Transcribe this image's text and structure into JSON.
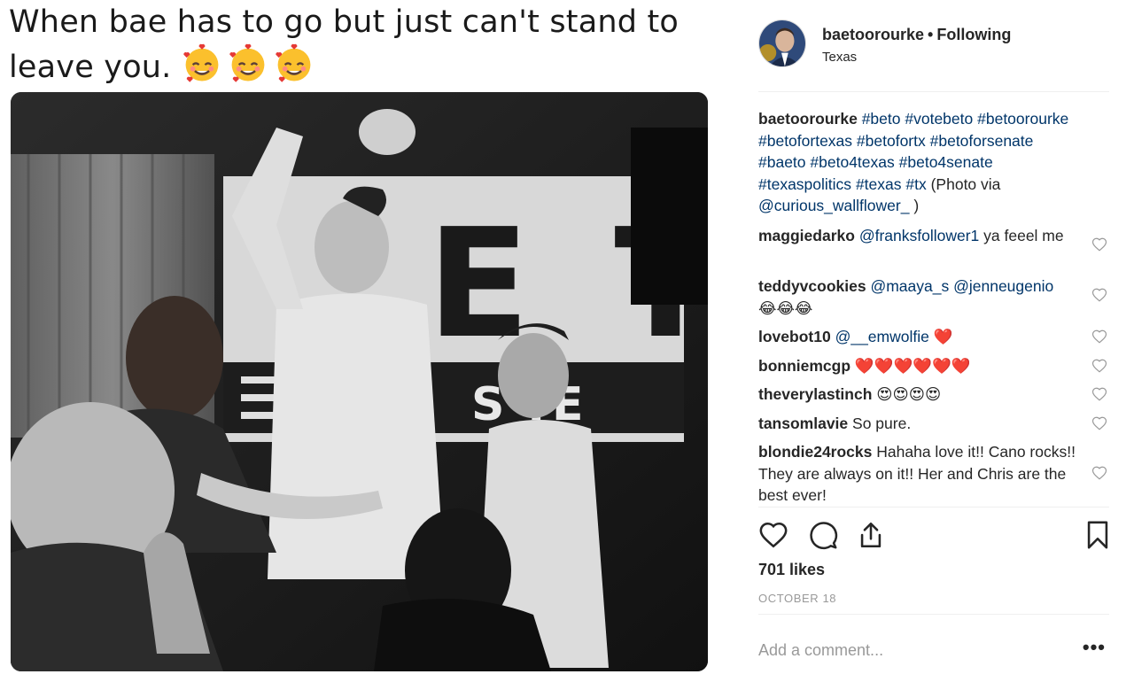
{
  "meme": {
    "caption_line1": "When bae has to go but just can't stand to",
    "caption_line2": "leave you.",
    "emoji": [
      "smiling-face-with-hearts",
      "smiling-face-with-hearts",
      "smiling-face-with-hearts"
    ],
    "banner_text": "ETO",
    "banner_sub": "SENATE"
  },
  "header": {
    "username": "baetoorourke",
    "separator": "•",
    "follow_status": "Following",
    "location": "Texas"
  },
  "caption": {
    "username": "baetoorourke",
    "hashtags": [
      "#beto",
      "#votebeto",
      "#betoorourke",
      "#betofortexas",
      "#betofortx",
      "#betoforsenate",
      "#baeto",
      "#beto4texas",
      "#beto4senate",
      "#texaspolitics",
      "#texas",
      "#tx"
    ],
    "credit_prefix": "(Photo via",
    "credit_handle": "@curious_wallflower_",
    "credit_suffix": ")"
  },
  "comments": [
    {
      "username": "maggiedarko",
      "mention": "@franksfollower1",
      "text": " ya feeel me"
    },
    {
      "username": "teddyvcookies",
      "mention": "@maaya_s @jenneugenio",
      "text": "",
      "emoji": "😂😂😂"
    },
    {
      "username": "lovebot10",
      "mention": "@__emwolfie",
      "text": "",
      "emoji": "❤️"
    },
    {
      "username": "bonniemcgp",
      "mention": "",
      "text": "",
      "emoji": "❤️❤️❤️❤️❤️❤️"
    },
    {
      "username": "theverylastinch",
      "mention": "",
      "text": "",
      "emoji": "😍😍😍😍"
    },
    {
      "username": "tansomlavie",
      "mention": "",
      "text": "So pure."
    },
    {
      "username": "blondie24rocks",
      "mention": "",
      "text": "Hahaha love it!! Cano rocks!! They are always on it!! Her and Chris are the best ever!"
    }
  ],
  "actions": {
    "like_icon": "heart-outline-icon",
    "comment_icon": "comment-bubble-icon",
    "share_icon": "share-upload-icon",
    "save_icon": "bookmark-icon"
  },
  "likes": "701 likes",
  "date": "OCTOBER 18",
  "add_comment": {
    "placeholder": "Add a comment...",
    "more": "•••"
  },
  "colors": {
    "hashtag": "#003569",
    "muted": "#999999",
    "text": "#262626",
    "border": "#efefef"
  }
}
